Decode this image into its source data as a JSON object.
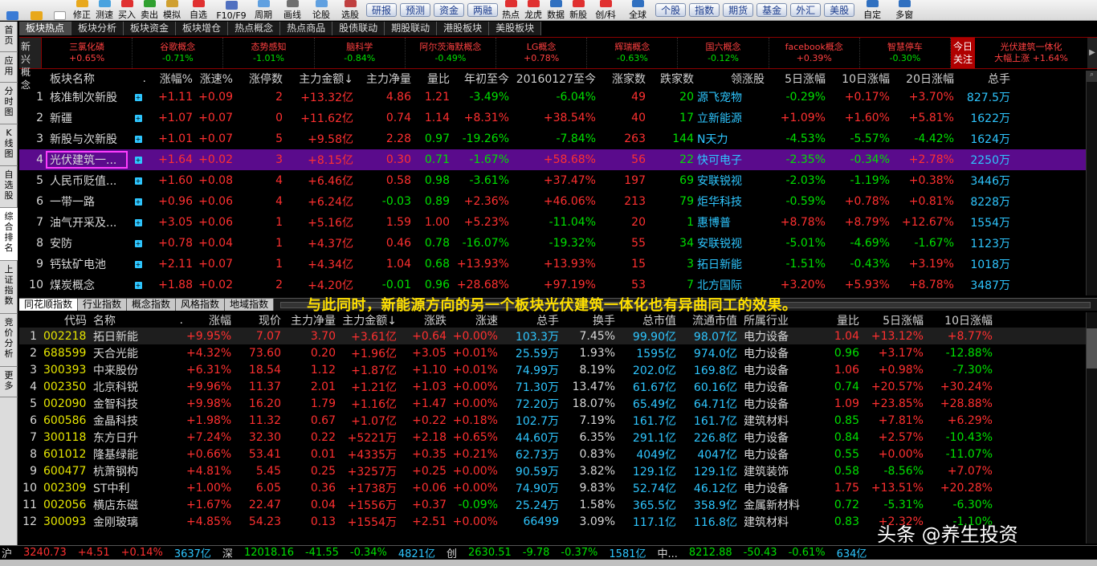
{
  "toolbar": {
    "buttons": [
      "修正",
      "测速",
      "买入",
      "卖出",
      "模拟",
      "自选",
      "F10/F9",
      "周期",
      "画线",
      "论股",
      "选股"
    ],
    "tabs": [
      "研报",
      "预测",
      "资金",
      "两融",
      "热点",
      "龙虎",
      "数据",
      "新股",
      "创/科",
      "全球",
      "个股",
      "指数",
      "期货",
      "基金",
      "外汇",
      "美股",
      "自定",
      "多窗"
    ]
  },
  "leftbar": [
    "首页",
    "应用",
    "分时图",
    "K线图",
    "自选股",
    "综合排名",
    "上证指数",
    "竞价分析",
    "更多"
  ],
  "section_tabs": [
    "板块热点",
    "板块分析",
    "板块资金",
    "板块增仓",
    "热点概念",
    "热点商品",
    "股债联动",
    "期股联动",
    "港股板块",
    "美股板块"
  ],
  "ticker": {
    "label": "新兴概念",
    "items": [
      {
        "name": "三氯化磷",
        "chg": "+0.65%",
        "dir": "up"
      },
      {
        "name": "谷歌概念",
        "chg": "-0.71%",
        "dir": "down"
      },
      {
        "name": "态势感知",
        "chg": "-1.01%",
        "dir": "down"
      },
      {
        "name": "脑科学",
        "chg": "-0.84%",
        "dir": "down"
      },
      {
        "name": "阿尔茨海默概念",
        "chg": "-0.49%",
        "dir": "down"
      },
      {
        "name": "LG概念",
        "chg": "+0.78%",
        "dir": "up"
      },
      {
        "name": "辉瑞概念",
        "chg": "-0.63%",
        "dir": "down"
      },
      {
        "name": "国六概念",
        "chg": "-0.12%",
        "dir": "down"
      },
      {
        "name": "facebook概念",
        "chg": "+0.39%",
        "dir": "up"
      },
      {
        "name": "智慧停车",
        "chg": "-0.30%",
        "dir": "down"
      }
    ],
    "focus_label": "今日关注",
    "focus_name": "光伏建筑一体化",
    "focus_text": "大幅上涨 +1.64%"
  },
  "upper_table": {
    "headers": [
      "板块名称",
      ".",
      "涨幅%",
      "涨速%",
      "涨停数",
      "主力金额↓",
      "主力净量",
      "量比",
      "年初至今",
      "20160127至今",
      "涨家数",
      "跌家数",
      "领涨股",
      "5日涨幅",
      "10日涨幅",
      "20日涨幅",
      "总手"
    ],
    "rows": [
      {
        "n": "1",
        "name": "核准制次新股",
        "chg": "+1.11",
        "spd": "+0.09",
        "lim": "2",
        "amt": "+13.32亿",
        "net": "4.86",
        "vr": "1.21",
        "ytd": "-3.49%",
        "since": "-6.04%",
        "up": "49",
        "dn": "20",
        "lead": "源飞宠物",
        "d5": "-0.29%",
        "d10": "+0.17%",
        "d20": "+3.70%",
        "vol": "827.5万"
      },
      {
        "n": "2",
        "name": "新疆",
        "chg": "+1.07",
        "spd": "+0.07",
        "lim": "0",
        "amt": "+11.62亿",
        "net": "0.74",
        "vr": "1.14",
        "ytd": "+8.31%",
        "since": "+38.54%",
        "up": "40",
        "dn": "17",
        "lead": "立新能源",
        "d5": "+1.09%",
        "d10": "+1.60%",
        "d20": "+5.81%",
        "vol": "1622万"
      },
      {
        "n": "3",
        "name": "新股与次新股",
        "chg": "+1.01",
        "spd": "+0.07",
        "lim": "5",
        "amt": "+9.58亿",
        "net": "2.28",
        "vr": "0.97",
        "ytd": "-19.26%",
        "since": "-7.84%",
        "up": "263",
        "dn": "144",
        "lead": "N天力",
        "d5": "-4.53%",
        "d10": "-5.57%",
        "d20": "-4.42%",
        "vol": "1624万"
      },
      {
        "n": "4",
        "name": "光伏建筑一...",
        "chg": "+1.64",
        "spd": "+0.02",
        "lim": "3",
        "amt": "+8.15亿",
        "net": "0.30",
        "vr": "0.71",
        "ytd": "-1.67%",
        "since": "+58.68%",
        "up": "56",
        "dn": "22",
        "lead": "快可电子",
        "d5": "-2.35%",
        "d10": "-0.34%",
        "d20": "+2.78%",
        "vol": "2250万"
      },
      {
        "n": "5",
        "name": "人民币贬值...",
        "chg": "+1.60",
        "spd": "+0.08",
        "lim": "4",
        "amt": "+6.46亿",
        "net": "0.58",
        "vr": "0.98",
        "ytd": "-3.61%",
        "since": "+37.47%",
        "up": "197",
        "dn": "69",
        "lead": "安联锐视",
        "d5": "-2.03%",
        "d10": "-1.19%",
        "d20": "+0.38%",
        "vol": "3446万"
      },
      {
        "n": "6",
        "name": "一带一路",
        "chg": "+0.96",
        "spd": "+0.06",
        "lim": "4",
        "amt": "+6.24亿",
        "net": "-0.03",
        "vr": "0.89",
        "ytd": "+2.36%",
        "since": "+46.06%",
        "up": "213",
        "dn": "79",
        "lead": "炬华科技",
        "d5": "-0.59%",
        "d10": "+0.78%",
        "d20": "+0.81%",
        "vol": "8228万"
      },
      {
        "n": "7",
        "name": "油气开采及...",
        "chg": "+3.05",
        "spd": "+0.06",
        "lim": "1",
        "amt": "+5.16亿",
        "net": "1.59",
        "vr": "1.00",
        "ytd": "+5.23%",
        "since": "-11.04%",
        "up": "20",
        "dn": "1",
        "lead": "惠博普",
        "d5": "+8.78%",
        "d10": "+8.79%",
        "d20": "+12.67%",
        "vol": "1554万"
      },
      {
        "n": "8",
        "name": "安防",
        "chg": "+0.78",
        "spd": "+0.04",
        "lim": "1",
        "amt": "+4.37亿",
        "net": "0.46",
        "vr": "0.78",
        "ytd": "-16.07%",
        "since": "-19.32%",
        "up": "55",
        "dn": "34",
        "lead": "安联锐视",
        "d5": "-5.01%",
        "d10": "-4.69%",
        "d20": "-1.67%",
        "vol": "1123万"
      },
      {
        "n": "9",
        "name": "钙钛矿电池",
        "chg": "+2.11",
        "spd": "+0.07",
        "lim": "1",
        "amt": "+4.34亿",
        "net": "1.04",
        "vr": "0.68",
        "ytd": "+13.93%",
        "since": "+13.93%",
        "up": "15",
        "dn": "3",
        "lead": "拓日新能",
        "d5": "-1.51%",
        "d10": "-0.43%",
        "d20": "+3.19%",
        "vol": "1018万"
      },
      {
        "n": "10",
        "name": "煤炭概念",
        "chg": "+1.88",
        "spd": "+0.02",
        "lim": "2",
        "amt": "+4.20亿",
        "net": "-0.01",
        "vr": "0.96",
        "ytd": "+28.68%",
        "since": "+97.19%",
        "up": "53",
        "dn": "7",
        "lead": "北方国际",
        "d5": "+3.20%",
        "d10": "+5.93%",
        "d20": "+8.78%",
        "vol": "3487万"
      }
    ]
  },
  "mid_tabs": [
    "同花顺指数",
    "行业指数",
    "概念指数",
    "风格指数",
    "地域指数"
  ],
  "subtitle": "与此同时，新能源方向的另一个板块光伏建筑一体化也有异曲同工的效果。",
  "lower_table": {
    "headers": [
      "代码",
      "名称",
      ".",
      "涨幅",
      "现价",
      "主力净量",
      "主力金额↓",
      "涨跌",
      "涨速",
      "总手",
      "换手",
      "总市值",
      "流通市值",
      "所属行业",
      "量比",
      "5日涨幅",
      "10日涨幅"
    ],
    "rows": [
      {
        "n": "1",
        "code": "002218",
        "name": "拓日新能",
        "chg": "+9.95%",
        "px": "7.07",
        "net": "3.70",
        "amt": "+3.61亿",
        "diff": "+0.64",
        "spd": "+0.00%",
        "vol": "103.3万",
        "tr": "7.45%",
        "mc": "99.90亿",
        "fmc": "98.07亿",
        "ind": "电力设备",
        "vr": "1.04",
        "d5": "+13.12%",
        "d10": "+8.77%"
      },
      {
        "n": "2",
        "code": "688599",
        "name": "天合光能",
        "chg": "+4.32%",
        "px": "73.60",
        "net": "0.20",
        "amt": "+1.96亿",
        "diff": "+3.05",
        "spd": "+0.01%",
        "vol": "25.59万",
        "tr": "1.93%",
        "mc": "1595亿",
        "fmc": "974.0亿",
        "ind": "电力设备",
        "vr": "0.96",
        "d5": "+3.17%",
        "d10": "-12.88%"
      },
      {
        "n": "3",
        "code": "300393",
        "name": "中来股份",
        "chg": "+6.31%",
        "px": "18.54",
        "net": "1.12",
        "amt": "+1.87亿",
        "diff": "+1.10",
        "spd": "+0.01%",
        "vol": "74.99万",
        "tr": "8.19%",
        "mc": "202.0亿",
        "fmc": "169.8亿",
        "ind": "电力设备",
        "vr": "1.06",
        "d5": "+0.98%",
        "d10": "-7.30%"
      },
      {
        "n": "4",
        "code": "002350",
        "name": "北京科锐",
        "chg": "+9.96%",
        "px": "11.37",
        "net": "2.01",
        "amt": "+1.21亿",
        "diff": "+1.03",
        "spd": "+0.00%",
        "vol": "71.30万",
        "tr": "13.47%",
        "mc": "61.67亿",
        "fmc": "60.16亿",
        "ind": "电力设备",
        "vr": "0.74",
        "d5": "+20.57%",
        "d10": "+30.24%"
      },
      {
        "n": "5",
        "code": "002090",
        "name": "金智科技",
        "chg": "+9.98%",
        "px": "16.20",
        "net": "1.79",
        "amt": "+1.16亿",
        "diff": "+1.47",
        "spd": "+0.00%",
        "vol": "72.20万",
        "tr": "18.07%",
        "mc": "65.49亿",
        "fmc": "64.71亿",
        "ind": "电力设备",
        "vr": "1.09",
        "d5": "+23.85%",
        "d10": "+28.88%"
      },
      {
        "n": "6",
        "code": "600586",
        "name": "金晶科技",
        "chg": "+1.98%",
        "px": "11.32",
        "net": "0.67",
        "amt": "+1.07亿",
        "diff": "+0.22",
        "spd": "+0.18%",
        "vol": "102.7万",
        "tr": "7.19%",
        "mc": "161.7亿",
        "fmc": "161.7亿",
        "ind": "建筑材料",
        "vr": "0.85",
        "d5": "+7.81%",
        "d10": "+6.29%"
      },
      {
        "n": "7",
        "code": "300118",
        "name": "东方日升",
        "chg": "+7.24%",
        "px": "32.30",
        "net": "0.22",
        "amt": "+5221万",
        "diff": "+2.18",
        "spd": "+0.65%",
        "vol": "44.60万",
        "tr": "6.35%",
        "mc": "291.1亿",
        "fmc": "226.8亿",
        "ind": "电力设备",
        "vr": "0.84",
        "d5": "+2.57%",
        "d10": "-10.43%"
      },
      {
        "n": "8",
        "code": "601012",
        "name": "隆基绿能",
        "chg": "+0.66%",
        "px": "53.41",
        "net": "0.01",
        "amt": "+4335万",
        "diff": "+0.35",
        "spd": "+0.21%",
        "vol": "62.73万",
        "tr": "0.83%",
        "mc": "4049亿",
        "fmc": "4047亿",
        "ind": "电力设备",
        "vr": "0.55",
        "d5": "+0.00%",
        "d10": "-11.07%"
      },
      {
        "n": "9",
        "code": "600477",
        "name": "杭萧钢构",
        "chg": "+4.81%",
        "px": "5.45",
        "net": "0.25",
        "amt": "+3257万",
        "diff": "+0.25",
        "spd": "+0.00%",
        "vol": "90.59万",
        "tr": "3.82%",
        "mc": "129.1亿",
        "fmc": "129.1亿",
        "ind": "建筑装饰",
        "vr": "0.58",
        "d5": "-8.56%",
        "d10": "+7.07%"
      },
      {
        "n": "10",
        "code": "002309",
        "name": "ST中利",
        "chg": "+1.00%",
        "px": "6.05",
        "net": "0.36",
        "amt": "+1738万",
        "diff": "+0.06",
        "spd": "+0.00%",
        "vol": "74.90万",
        "tr": "9.83%",
        "mc": "52.74亿",
        "fmc": "46.12亿",
        "ind": "电力设备",
        "vr": "1.75",
        "d5": "+13.51%",
        "d10": "+20.28%"
      },
      {
        "n": "11",
        "code": "002056",
        "name": "横店东磁",
        "chg": "+1.67%",
        "px": "22.47",
        "net": "0.04",
        "amt": "+1556万",
        "diff": "+0.37",
        "spd": "-0.09%",
        "vol": "25.24万",
        "tr": "1.58%",
        "mc": "365.5亿",
        "fmc": "358.9亿",
        "ind": "金属新材料",
        "vr": "0.72",
        "d5": "-5.31%",
        "d10": "-6.30%"
      },
      {
        "n": "12",
        "code": "300093",
        "name": "金刚玻璃",
        "chg": "+4.85%",
        "px": "54.23",
        "net": "0.13",
        "amt": "+1554万",
        "diff": "+2.51",
        "spd": "+0.00%",
        "vol": "66499",
        "tr": "3.09%",
        "mc": "117.1亿",
        "fmc": "116.8亿",
        "ind": "建筑材料",
        "vr": "0.83",
        "d5": "+2.32%",
        "d10": "-1.10%"
      }
    ]
  },
  "status": {
    "sh_label": "沪",
    "sh_val": "3240.73",
    "sh_diff": "+4.51",
    "sh_pct": "+0.14%",
    "sh_amt": "3637亿",
    "sz_label": "深",
    "sz_val": "12018.16",
    "sz_diff": "-41.55",
    "sz_pct": "-0.34%",
    "sz_amt": "4821亿",
    "cy_label": "创",
    "cy_val": "2630.51",
    "cy_diff": "-9.78",
    "cy_pct": "-0.37%",
    "cy_amt": "1581亿",
    "zx_label": "中...",
    "zx_val": "8212.88",
    "zx_diff": "-50.43",
    "zx_pct": "-0.61%",
    "zx_amt": "634亿"
  },
  "watermark": "头条 @养生投资",
  "colors": {
    "up": "#ff3030",
    "down": "#00e000",
    "selected_row": "#5a0b8c",
    "accent_cyan": "#2ec6ff",
    "subtitle": "#ffe000"
  }
}
